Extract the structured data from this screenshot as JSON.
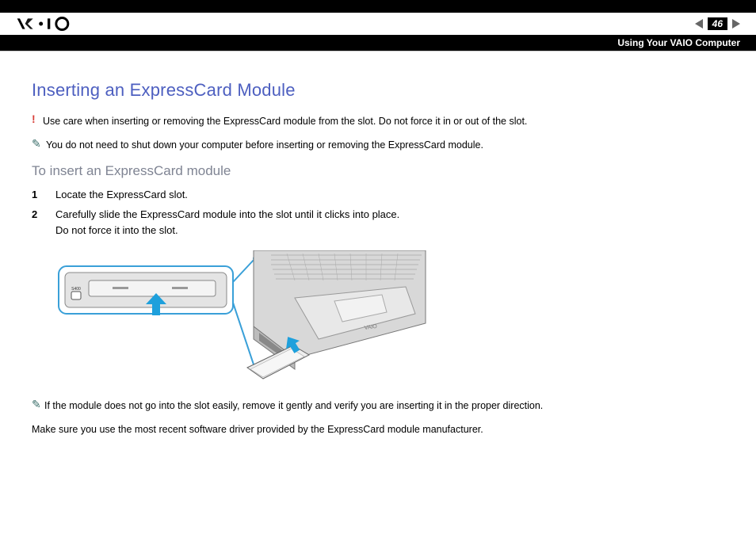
{
  "header": {
    "page_number": "46",
    "section": "Using Your VAIO Computer"
  },
  "title": "Inserting an ExpressCard Module",
  "warning": "Use care when inserting or removing the ExpressCard module from the slot. Do not force it in or out of the slot.",
  "tip1": "You do not need to shut down your computer before inserting or removing the ExpressCard module.",
  "subtitle": "To insert an ExpressCard module",
  "steps": [
    {
      "num": "1",
      "text": "Locate the ExpressCard slot."
    },
    {
      "num": "2",
      "text": "Carefully slide the ExpressCard module into the slot until it clicks into place.\nDo not force it into the slot."
    }
  ],
  "tip2": "If the module does not go into the slot easily, remove it gently and verify you are inserting it in the proper direction.",
  "closing": "Make sure you use the most recent software driver provided by the ExpressCard module manufacturer."
}
